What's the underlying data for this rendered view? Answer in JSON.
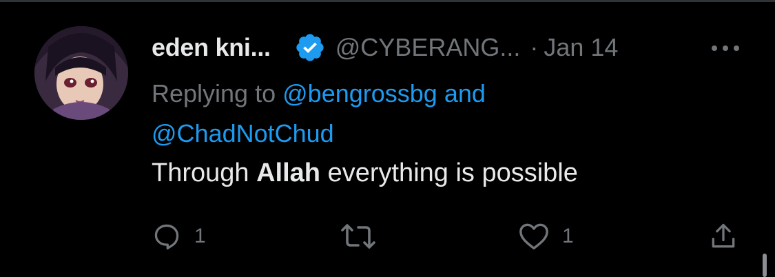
{
  "tweet": {
    "display_name": "eden kni...",
    "handle": "@CYBERANG...",
    "separator": "·",
    "date": "Jan 14",
    "replying_prefix": "Replying to",
    "reply_mention_1": "@bengrossbg",
    "reply_conjunction": "and",
    "reply_mention_2": "@ChadNotChud",
    "text_before": "Through",
    "text_bold": "Allah",
    "text_after": "everything is possible"
  },
  "actions": {
    "reply_count": "1",
    "like_count": "1"
  },
  "icons": {
    "verified": "verified-badge-icon",
    "more": "more-horizontal-icon",
    "reply": "reply-icon",
    "retweet": "retweet-icon",
    "like": "heart-icon",
    "share": "share-icon"
  },
  "colors": {
    "background": "#000000",
    "text": "#e7e9ea",
    "secondary": "#71767b",
    "accent": "#1d9bf0"
  }
}
